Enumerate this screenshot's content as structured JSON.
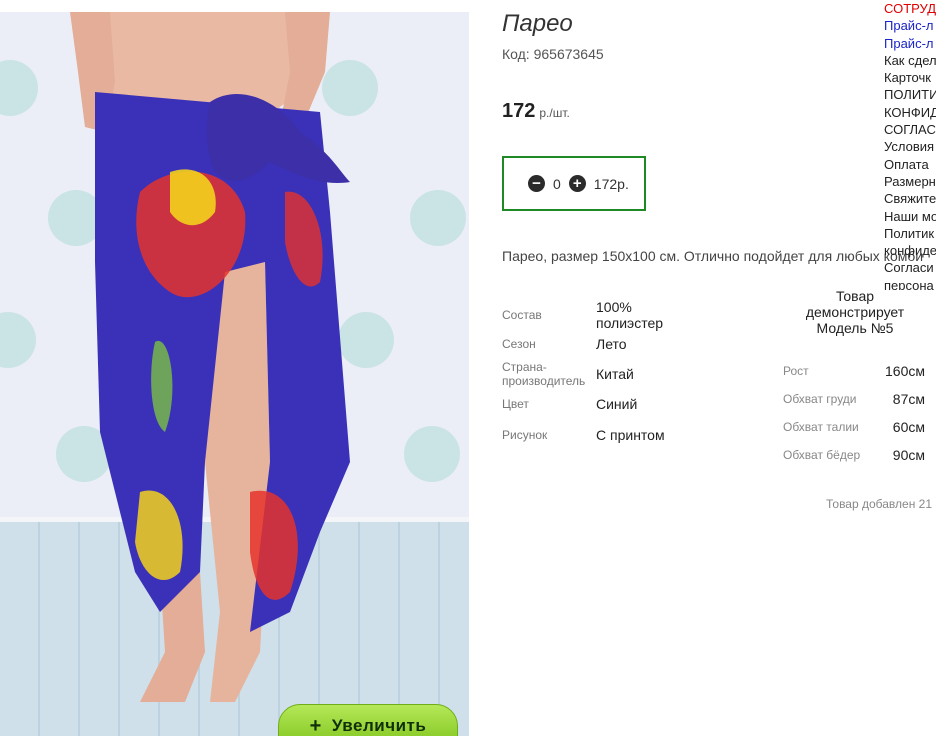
{
  "product": {
    "title": "Парео",
    "code": "Код: 965673645",
    "price": "172",
    "price_unit": "р./шт.",
    "zoom_label": "Увеличить"
  },
  "cart": {
    "quantity": "0",
    "total": "172р."
  },
  "description": "Парео, размер 150x100 см. Отлично подойдет для любых комби",
  "specs": [
    {
      "key": "Состав",
      "value": "100% полиэстер"
    },
    {
      "key": "Сезон",
      "value": "Лето"
    },
    {
      "key": "Страна-производитель",
      "value": "Китай"
    },
    {
      "key": "Цвет",
      "value": "Синий"
    },
    {
      "key": "Рисунок",
      "value": "С принтом"
    }
  ],
  "model": {
    "heading": "Товар демонстрирует Модель №5",
    "params": [
      {
        "key": "Рост",
        "value": "160см"
      },
      {
        "key": "Обхват груди",
        "value": "87см"
      },
      {
        "key": "Обхват талии",
        "value": "60см"
      },
      {
        "key": "Обхват бёдер",
        "value": "90см"
      }
    ]
  },
  "added": "Товар добавлен 21",
  "side_menu": [
    {
      "label": "СОТРУД",
      "color": "red"
    },
    {
      "label": "Прайс-л",
      "color": "blue"
    },
    {
      "label": "Прайс-л",
      "color": "blue"
    },
    {
      "label": "Как сдел",
      "color": "default"
    },
    {
      "label": "Карточк",
      "color": "default"
    },
    {
      "label": "ПОЛИТИ",
      "color": "default"
    },
    {
      "label": "КОНФИД",
      "color": "default"
    },
    {
      "label": "СОГЛАС",
      "color": "default"
    },
    {
      "label": "Условия",
      "color": "default"
    },
    {
      "label": "Оплата",
      "color": "default"
    },
    {
      "label": "Размерн",
      "color": "default"
    },
    {
      "label": "Свяжите",
      "color": "default"
    },
    {
      "label": "Наши мо",
      "color": "default"
    },
    {
      "label": "Политик",
      "color": "default"
    },
    {
      "label": "конфиде",
      "color": "default"
    },
    {
      "label": "Согласи",
      "color": "default"
    },
    {
      "label": "персона",
      "color": "default"
    }
  ],
  "colors": {
    "qty_border": "#1f8a25",
    "zoom_button": "#8fd22a",
    "menu_red": "#e00000",
    "menu_blue": "#1b24c7"
  }
}
